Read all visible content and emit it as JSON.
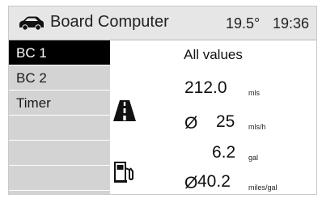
{
  "header": {
    "title": "Board Computer",
    "temperature": "19.5°",
    "time": "19:36",
    "car_icon": "car-icon"
  },
  "sidebar": {
    "items": [
      {
        "label": "BC 1",
        "selected": true
      },
      {
        "label": "BC 2",
        "selected": false
      },
      {
        "label": "Timer",
        "selected": false
      }
    ]
  },
  "main": {
    "heading": "All values",
    "distance": {
      "value": "212.0",
      "unit": "mls",
      "icon": "road-icon"
    },
    "avg_speed": {
      "symbol": "Ø",
      "value": "25",
      "unit": "mls/h"
    },
    "fuel_used": {
      "value": "6.2",
      "unit": "gal",
      "icon": "fuel-pump-icon"
    },
    "avg_consumption": {
      "symbol": "Ø",
      "value": "40.2",
      "unit": "miles/gal"
    }
  },
  "colors": {
    "header_bg": "#e6e6e6",
    "sidebar_bg": "#d3d3d3",
    "selected_bg": "#000000",
    "selected_text": "#ffffff"
  }
}
